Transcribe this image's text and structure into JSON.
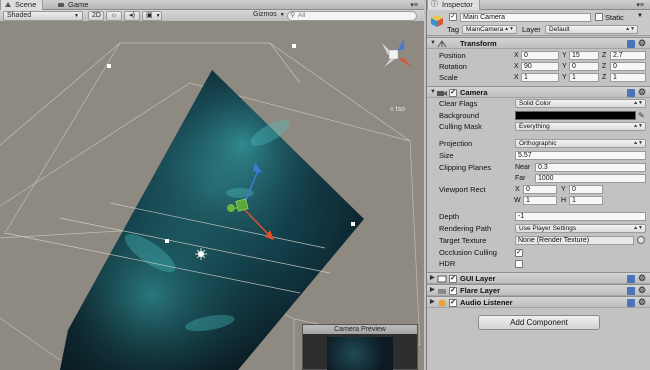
{
  "scene_panel": {
    "tabs": [
      {
        "label": "Scene",
        "icon": "scene-icon"
      },
      {
        "label": "Game",
        "icon": "game-icon"
      }
    ],
    "toolbar": {
      "shading_mode": "Shaded",
      "mode_2d": "2D",
      "gizmos": "Gizmos",
      "search_placeholder": "All"
    },
    "iso_label": "Iso",
    "camera_preview_title": "Camera Preview",
    "colors": {
      "scene_bg": "#8e8981",
      "axis_x": "#e0502a",
      "axis_y": "#6cb63a",
      "axis_z": "#3f7ad6"
    }
  },
  "inspector": {
    "tab_label": "Inspector",
    "object": {
      "name": "Main Camera",
      "static_label": "Static",
      "tag_label": "Tag",
      "tag_value": "MainCamera",
      "layer_label": "Layer",
      "layer_value": "Default"
    },
    "transform": {
      "title": "Transform",
      "position_label": "Position",
      "rotation_label": "Rotation",
      "scale_label": "Scale",
      "position": {
        "x": "0",
        "y": "15",
        "z": "2.7"
      },
      "rotation": {
        "x": "90",
        "y": "0",
        "z": "0"
      },
      "scale": {
        "x": "1",
        "y": "1",
        "z": "1"
      }
    },
    "camera": {
      "title": "Camera",
      "clear_flags_label": "Clear Flags",
      "clear_flags_value": "Solid Color",
      "background_label": "Background",
      "culling_mask_label": "Culling Mask",
      "culling_mask_value": "Everything",
      "projection_label": "Projection",
      "projection_value": "Orthographic",
      "size_label": "Size",
      "size_value": "5.57",
      "clipping_label": "Clipping Planes",
      "near_label": "Near",
      "near_value": "0.3",
      "far_label": "Far",
      "far_value": "1000",
      "viewport_label": "Viewport Rect",
      "viewport": {
        "x": "0",
        "y": "0",
        "w": "1",
        "h": "1"
      },
      "depth_label": "Depth",
      "depth_value": "-1",
      "rendering_path_label": "Rendering Path",
      "rendering_path_value": "Use Player Settings",
      "target_texture_label": "Target Texture",
      "target_texture_value": "None (Render Texture)",
      "occlusion_label": "Occlusion Culling",
      "hdr_label": "HDR"
    },
    "components": [
      {
        "title": "GUI Layer",
        "icon": "gui-layer-icon"
      },
      {
        "title": "Flare Layer",
        "icon": "flare-layer-icon"
      },
      {
        "title": "Audio Listener",
        "icon": "audio-listener-icon"
      }
    ],
    "add_component_label": "Add Component"
  }
}
